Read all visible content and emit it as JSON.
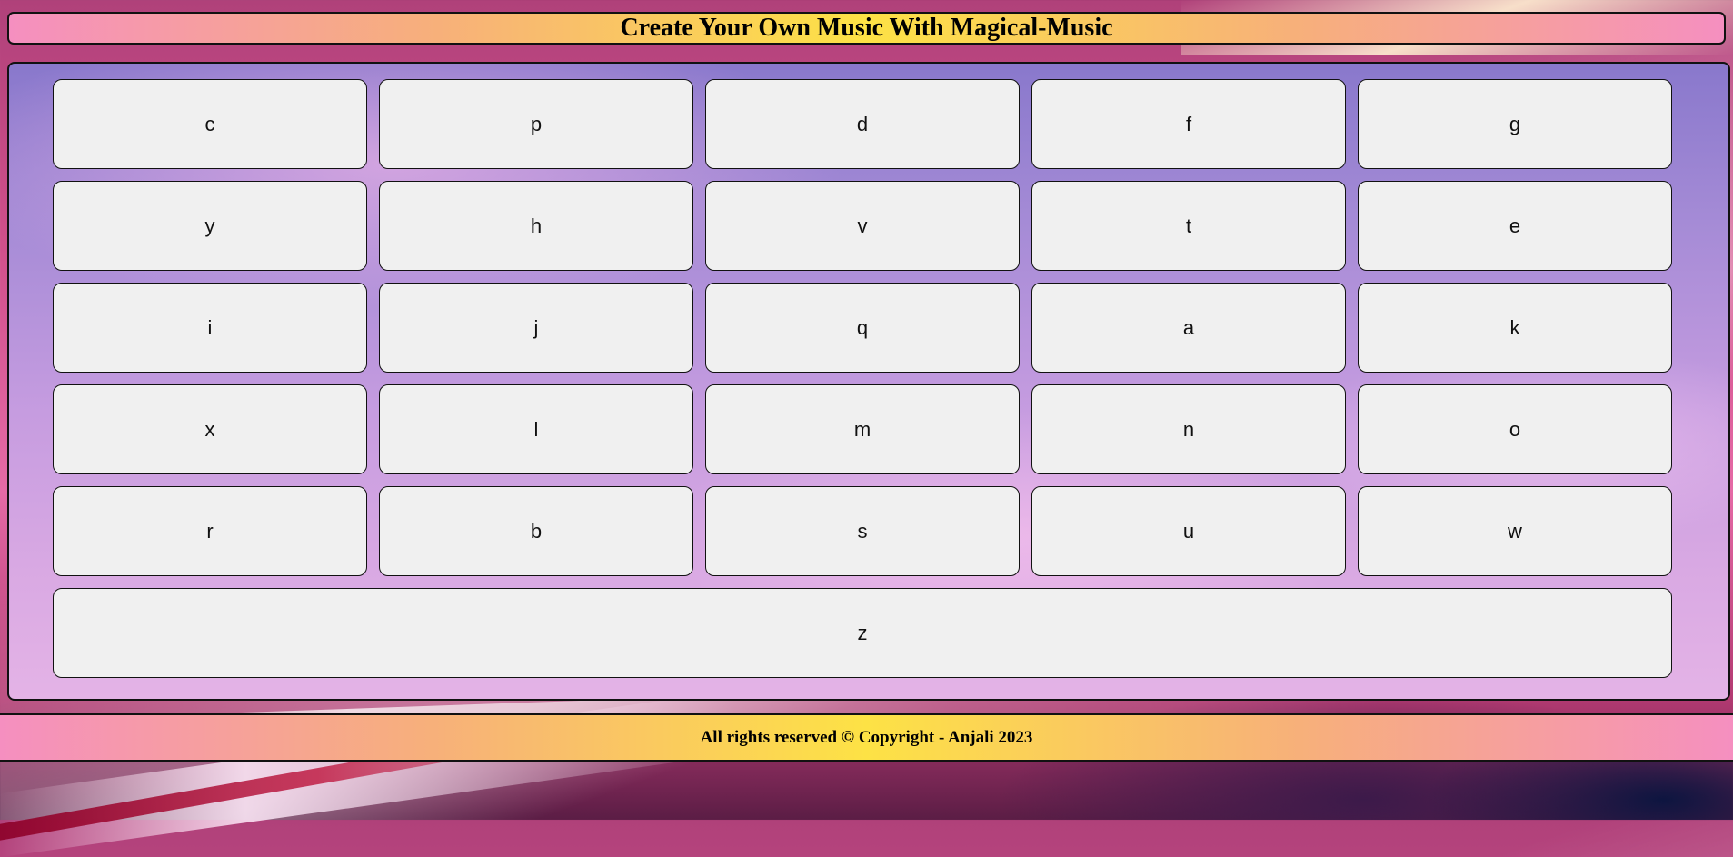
{
  "header": {
    "title": "Create Your Own Music With Magical-Music"
  },
  "keys": {
    "row1": [
      "c",
      "p",
      "d",
      "f",
      "g"
    ],
    "row2": [
      "y",
      "h",
      "v",
      "t",
      "e"
    ],
    "row3": [
      "i",
      "j",
      "q",
      "a",
      "k"
    ],
    "row4": [
      "x",
      "l",
      "m",
      "n",
      "o"
    ],
    "row5": [
      "r",
      "b",
      "s",
      "u",
      "w"
    ],
    "row6": [
      "z"
    ]
  },
  "footer": {
    "copyright": "All rights reserved © Copyright - Anjali 2023"
  }
}
